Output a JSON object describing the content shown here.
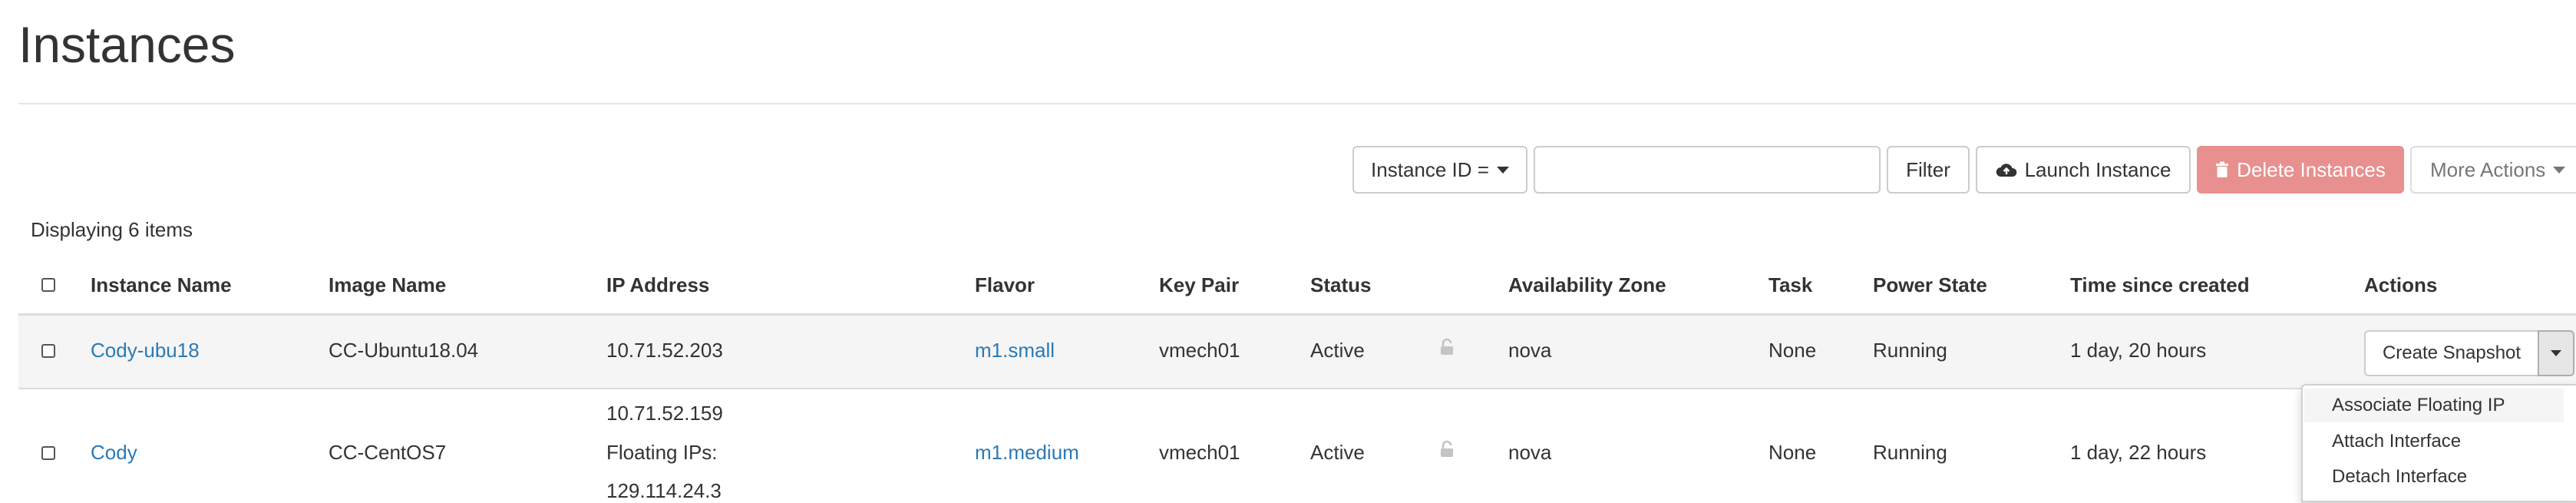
{
  "page": {
    "title": "Instances"
  },
  "toolbar": {
    "filter_field": "Instance ID =",
    "filter_value": "",
    "filter_button": "Filter",
    "launch": "Launch Instance",
    "delete": "Delete Instances",
    "more": "More Actions"
  },
  "summary": {
    "count_text": "Displaying 6 items"
  },
  "table": {
    "headers": {
      "name": "Instance Name",
      "image": "Image Name",
      "ip": "IP Address",
      "flavor": "Flavor",
      "keypair": "Key Pair",
      "status": "Status",
      "zone": "Availability Zone",
      "task": "Task",
      "power": "Power State",
      "time": "Time since created",
      "actions": "Actions"
    },
    "rows": [
      {
        "name": "Cody-ubu18",
        "image": "CC-Ubuntu18.04",
        "ip_lines": [
          "10.71.52.203"
        ],
        "flavor": "m1.small",
        "keypair": "vmech01",
        "status": "Active",
        "zone": "nova",
        "task": "None",
        "power": "Running",
        "time": "1 day, 20 hours",
        "action": "Create Snapshot"
      },
      {
        "name": "Cody",
        "image": "CC-CentOS7",
        "ip_lines": [
          "10.71.52.159",
          "Floating IPs:",
          "129.114.24.3"
        ],
        "flavor": "m1.medium",
        "keypair": "vmech01",
        "status": "Active",
        "zone": "nova",
        "task": "None",
        "power": "Running",
        "time": "1 day, 22 hours"
      }
    ]
  },
  "dropdown": {
    "items": [
      "Associate Floating IP",
      "Attach Interface",
      "Detach Interface"
    ]
  },
  "colors": {
    "link": "#2a7ab8",
    "danger": "#e8908f"
  }
}
